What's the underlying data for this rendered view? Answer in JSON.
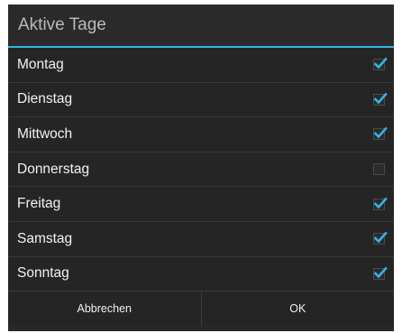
{
  "dialog": {
    "title": "Aktive Tage",
    "accent_color": "#33b5e5",
    "days": [
      {
        "label": "Montag",
        "checked": true
      },
      {
        "label": "Dienstag",
        "checked": true
      },
      {
        "label": "Mittwoch",
        "checked": true
      },
      {
        "label": "Donnerstag",
        "checked": false
      },
      {
        "label": "Freitag",
        "checked": true
      },
      {
        "label": "Samstag",
        "checked": true
      },
      {
        "label": "Sonntag",
        "checked": true
      }
    ],
    "cancel_label": "Abbrechen",
    "ok_label": "OK"
  }
}
